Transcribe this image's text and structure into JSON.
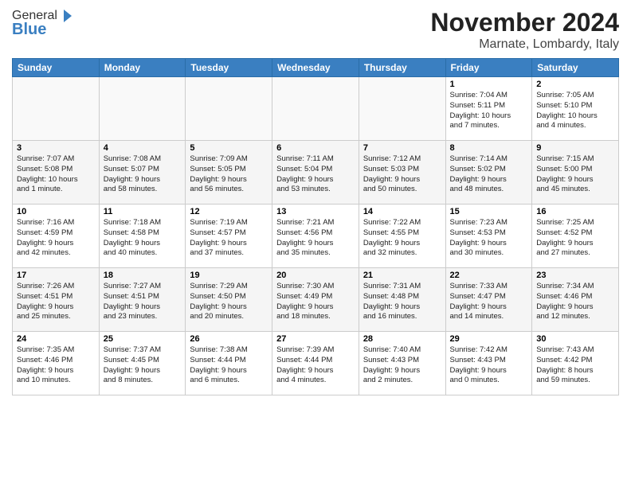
{
  "logo": {
    "general": "General",
    "blue": "Blue"
  },
  "title": "November 2024",
  "location": "Marnate, Lombardy, Italy",
  "days_header": [
    "Sunday",
    "Monday",
    "Tuesday",
    "Wednesday",
    "Thursday",
    "Friday",
    "Saturday"
  ],
  "weeks": [
    [
      {
        "num": "",
        "info": ""
      },
      {
        "num": "",
        "info": ""
      },
      {
        "num": "",
        "info": ""
      },
      {
        "num": "",
        "info": ""
      },
      {
        "num": "",
        "info": ""
      },
      {
        "num": "1",
        "info": "Sunrise: 7:04 AM\nSunset: 5:11 PM\nDaylight: 10 hours\nand 7 minutes."
      },
      {
        "num": "2",
        "info": "Sunrise: 7:05 AM\nSunset: 5:10 PM\nDaylight: 10 hours\nand 4 minutes."
      }
    ],
    [
      {
        "num": "3",
        "info": "Sunrise: 7:07 AM\nSunset: 5:08 PM\nDaylight: 10 hours\nand 1 minute."
      },
      {
        "num": "4",
        "info": "Sunrise: 7:08 AM\nSunset: 5:07 PM\nDaylight: 9 hours\nand 58 minutes."
      },
      {
        "num": "5",
        "info": "Sunrise: 7:09 AM\nSunset: 5:05 PM\nDaylight: 9 hours\nand 56 minutes."
      },
      {
        "num": "6",
        "info": "Sunrise: 7:11 AM\nSunset: 5:04 PM\nDaylight: 9 hours\nand 53 minutes."
      },
      {
        "num": "7",
        "info": "Sunrise: 7:12 AM\nSunset: 5:03 PM\nDaylight: 9 hours\nand 50 minutes."
      },
      {
        "num": "8",
        "info": "Sunrise: 7:14 AM\nSunset: 5:02 PM\nDaylight: 9 hours\nand 48 minutes."
      },
      {
        "num": "9",
        "info": "Sunrise: 7:15 AM\nSunset: 5:00 PM\nDaylight: 9 hours\nand 45 minutes."
      }
    ],
    [
      {
        "num": "10",
        "info": "Sunrise: 7:16 AM\nSunset: 4:59 PM\nDaylight: 9 hours\nand 42 minutes."
      },
      {
        "num": "11",
        "info": "Sunrise: 7:18 AM\nSunset: 4:58 PM\nDaylight: 9 hours\nand 40 minutes."
      },
      {
        "num": "12",
        "info": "Sunrise: 7:19 AM\nSunset: 4:57 PM\nDaylight: 9 hours\nand 37 minutes."
      },
      {
        "num": "13",
        "info": "Sunrise: 7:21 AM\nSunset: 4:56 PM\nDaylight: 9 hours\nand 35 minutes."
      },
      {
        "num": "14",
        "info": "Sunrise: 7:22 AM\nSunset: 4:55 PM\nDaylight: 9 hours\nand 32 minutes."
      },
      {
        "num": "15",
        "info": "Sunrise: 7:23 AM\nSunset: 4:53 PM\nDaylight: 9 hours\nand 30 minutes."
      },
      {
        "num": "16",
        "info": "Sunrise: 7:25 AM\nSunset: 4:52 PM\nDaylight: 9 hours\nand 27 minutes."
      }
    ],
    [
      {
        "num": "17",
        "info": "Sunrise: 7:26 AM\nSunset: 4:51 PM\nDaylight: 9 hours\nand 25 minutes."
      },
      {
        "num": "18",
        "info": "Sunrise: 7:27 AM\nSunset: 4:51 PM\nDaylight: 9 hours\nand 23 minutes."
      },
      {
        "num": "19",
        "info": "Sunrise: 7:29 AM\nSunset: 4:50 PM\nDaylight: 9 hours\nand 20 minutes."
      },
      {
        "num": "20",
        "info": "Sunrise: 7:30 AM\nSunset: 4:49 PM\nDaylight: 9 hours\nand 18 minutes."
      },
      {
        "num": "21",
        "info": "Sunrise: 7:31 AM\nSunset: 4:48 PM\nDaylight: 9 hours\nand 16 minutes."
      },
      {
        "num": "22",
        "info": "Sunrise: 7:33 AM\nSunset: 4:47 PM\nDaylight: 9 hours\nand 14 minutes."
      },
      {
        "num": "23",
        "info": "Sunrise: 7:34 AM\nSunset: 4:46 PM\nDaylight: 9 hours\nand 12 minutes."
      }
    ],
    [
      {
        "num": "24",
        "info": "Sunrise: 7:35 AM\nSunset: 4:46 PM\nDaylight: 9 hours\nand 10 minutes."
      },
      {
        "num": "25",
        "info": "Sunrise: 7:37 AM\nSunset: 4:45 PM\nDaylight: 9 hours\nand 8 minutes."
      },
      {
        "num": "26",
        "info": "Sunrise: 7:38 AM\nSunset: 4:44 PM\nDaylight: 9 hours\nand 6 minutes."
      },
      {
        "num": "27",
        "info": "Sunrise: 7:39 AM\nSunset: 4:44 PM\nDaylight: 9 hours\nand 4 minutes."
      },
      {
        "num": "28",
        "info": "Sunrise: 7:40 AM\nSunset: 4:43 PM\nDaylight: 9 hours\nand 2 minutes."
      },
      {
        "num": "29",
        "info": "Sunrise: 7:42 AM\nSunset: 4:43 PM\nDaylight: 9 hours\nand 0 minutes."
      },
      {
        "num": "30",
        "info": "Sunrise: 7:43 AM\nSunset: 4:42 PM\nDaylight: 8 hours\nand 59 minutes."
      }
    ]
  ]
}
